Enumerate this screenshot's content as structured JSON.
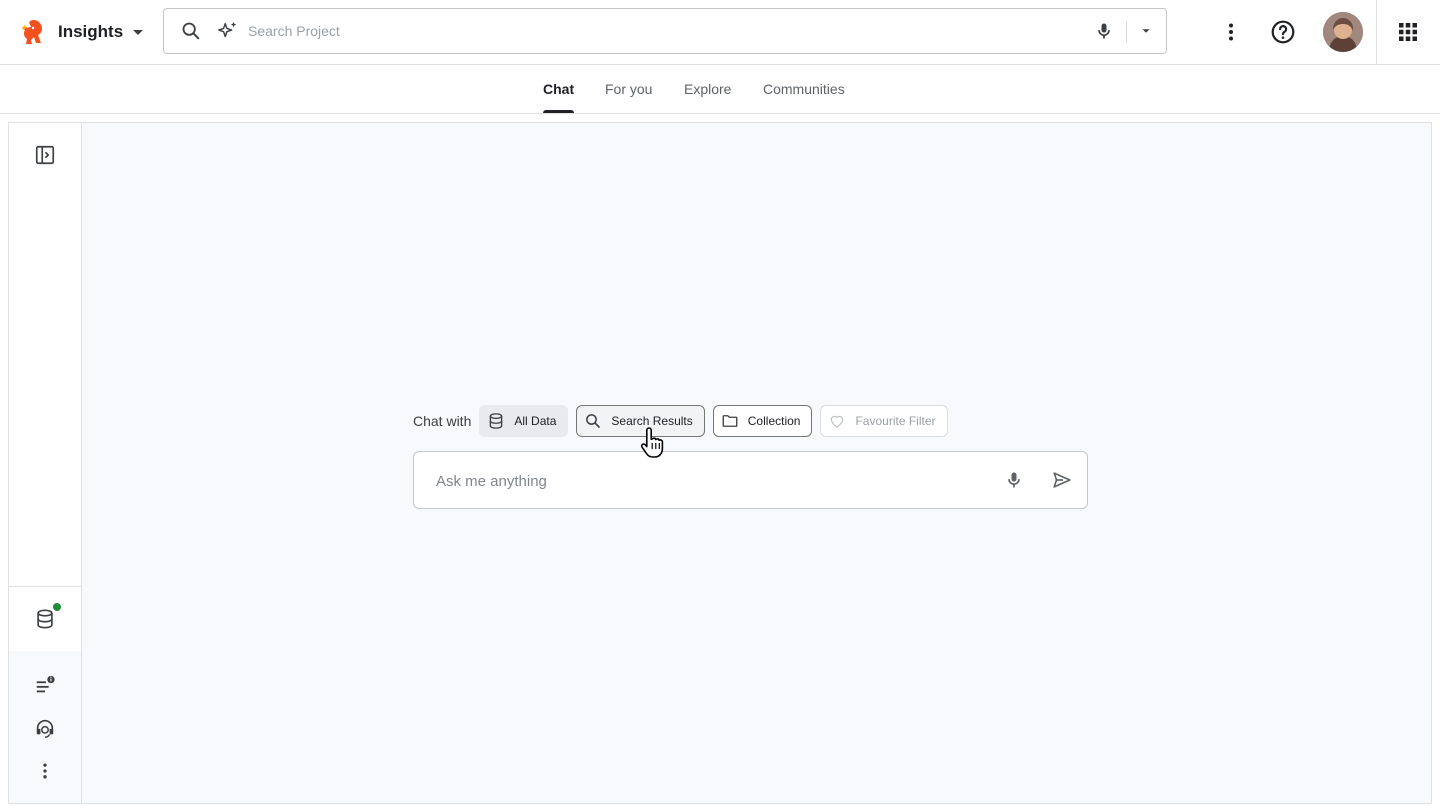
{
  "app": {
    "name": "Insights",
    "icons": {
      "logo": "squirrel-logo",
      "caret": "caret-down-icon"
    }
  },
  "search": {
    "placeholder": "Search Project",
    "icons": [
      "search-icon",
      "sparkle-icon",
      "mic-icon",
      "caret-down-icon"
    ]
  },
  "toolbar": {
    "icons": [
      "more-vert-icon",
      "help-icon",
      "avatar",
      "apps-grid-icon"
    ]
  },
  "tabs": [
    {
      "label": "Chat",
      "active": true
    },
    {
      "label": "For you",
      "active": false
    },
    {
      "label": "Explore",
      "active": false
    },
    {
      "label": "Communities",
      "active": false
    }
  ],
  "rail": {
    "icons": [
      "sidebar-expand-icon",
      "database-icon",
      "notes-info-icon",
      "support-agent-icon",
      "more-vert-icon"
    ],
    "status_dot_color": "#1e8e3e"
  },
  "chat": {
    "with_label": "Chat with",
    "chips": [
      {
        "label": "All Data",
        "icon": "database-icon",
        "state": "selected"
      },
      {
        "label": "Search Results",
        "icon": "search-icon",
        "state": "hover"
      },
      {
        "label": "Collection",
        "icon": "folder-icon",
        "state": "default"
      },
      {
        "label": "Favourite Filter",
        "icon": "heart-icon",
        "state": "disabled"
      }
    ],
    "input_placeholder": "Ask me anything",
    "input_icons": [
      "mic-icon",
      "send-icon"
    ]
  },
  "colors": {
    "accent": "#202124",
    "canvas": "#f8f9fc",
    "border": "#e0e0e0"
  }
}
